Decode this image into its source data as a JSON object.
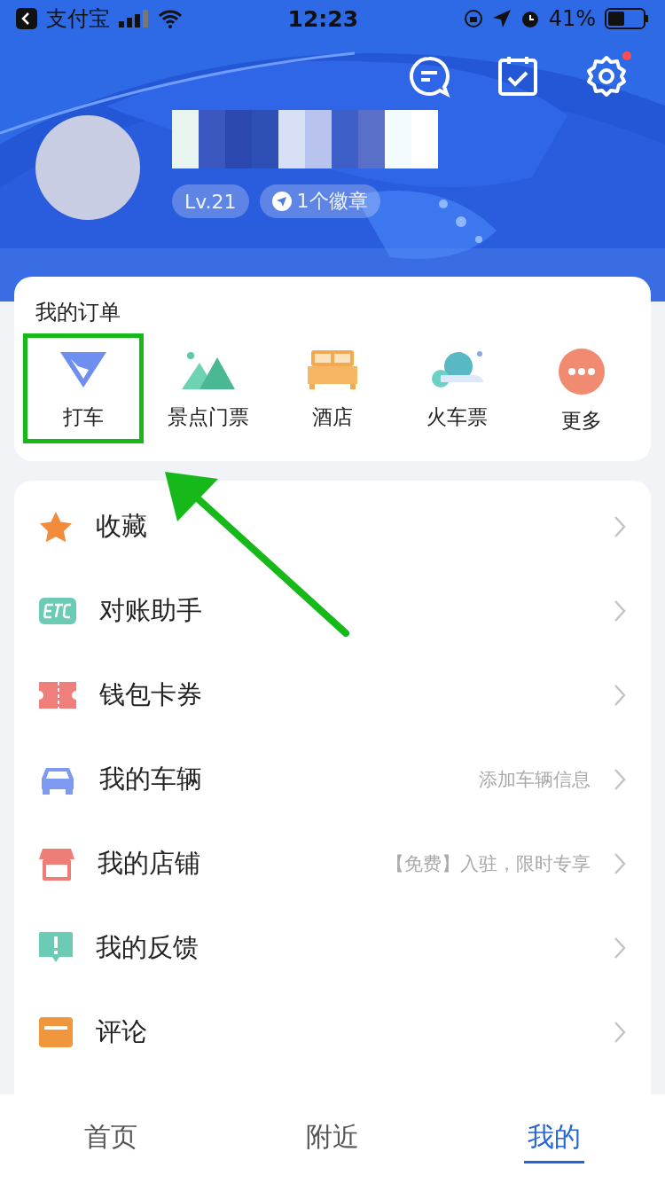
{
  "status_bar": {
    "back_app": "支付宝",
    "time": "12:23",
    "battery": "41%"
  },
  "header": {
    "settings_badge": true,
    "level": "Lv.21",
    "badges": "1个徽章"
  },
  "orders": {
    "title": "我的订单",
    "items": [
      {
        "kind": "taxi",
        "label": "打车",
        "highlighted": true
      },
      {
        "kind": "scenic",
        "label": "景点门票",
        "highlighted": false
      },
      {
        "kind": "hotel",
        "label": "酒店",
        "highlighted": false
      },
      {
        "kind": "train",
        "label": "火车票",
        "highlighted": false
      },
      {
        "kind": "more",
        "label": "更多",
        "highlighted": false
      }
    ]
  },
  "menu": [
    {
      "kind": "star",
      "label": "收藏"
    },
    {
      "kind": "etc",
      "label": "对账助手"
    },
    {
      "kind": "ticket",
      "label": "钱包卡券"
    },
    {
      "kind": "car",
      "label": "我的车辆",
      "hint": "添加车辆信息"
    },
    {
      "kind": "shop",
      "label": "我的店铺",
      "hint": "【免费】入驻，限时专享"
    },
    {
      "kind": "feedback",
      "label": "我的反馈"
    },
    {
      "kind": "comment",
      "label": "评论"
    }
  ],
  "tabs": [
    {
      "label": "首页",
      "selected": false
    },
    {
      "label": "附近",
      "selected": false
    },
    {
      "label": "我的",
      "selected": true
    }
  ]
}
